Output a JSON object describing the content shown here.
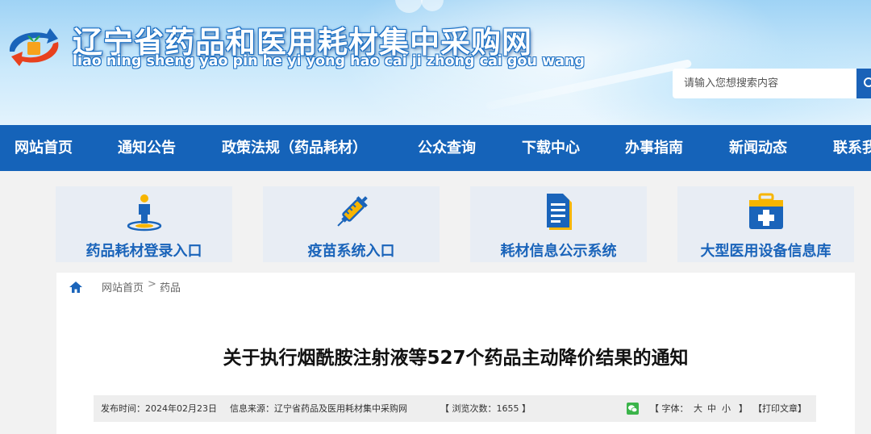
{
  "header": {
    "site_title": "辽宁省药品和医用耗材集中采购网",
    "site_pinyin": "liao ning sheng yao pin he yi yong hao cai ji zhong cai gou wang",
    "logo_icon": "arrow-swirl-logo-icon",
    "search_placeholder": "请输入您想搜索内容",
    "search_icon": "search-icon"
  },
  "nav": {
    "items": [
      {
        "label": "网站首页"
      },
      {
        "label": "通知公告"
      },
      {
        "label": "政策法规（药品耗材）"
      },
      {
        "label": "公众查询"
      },
      {
        "label": "下载中心"
      },
      {
        "label": "办事指南"
      },
      {
        "label": "新闻动态"
      },
      {
        "label": "联系我们"
      }
    ]
  },
  "entries": [
    {
      "label": "药品耗材登录入口",
      "icon": "person-pin-icon"
    },
    {
      "label": "疫苗系统入口",
      "icon": "syringe-icon"
    },
    {
      "label": "耗材信息公示系统",
      "icon": "document-icon"
    },
    {
      "label": "大型医用设备信息库",
      "icon": "medical-kit-icon"
    }
  ],
  "breadcrumb": {
    "home_icon": "home-icon",
    "items": [
      "网站首页",
      "药品"
    ],
    "separator": ">"
  },
  "article": {
    "title": "关于执行烟酰胺注射液等527个药品主动降价结果的通知",
    "publish_time": "发布时间：2024年02月23日",
    "source": "信息来源：辽宁省药品及医用耗材集中采购网",
    "views": "【 浏览次数：1655 】",
    "wechat_icon": "wechat-icon",
    "font_size_label": "【 字体：",
    "font_large": "大",
    "font_medium": "中",
    "font_small": "小",
    "font_size_close": "】",
    "print_label": "【打印文章】"
  },
  "colors": {
    "nav_bg": "#1563b9",
    "accent": "#1a64ba",
    "card_bg": "#e8edf4",
    "icon_yellow": "#f7b500"
  }
}
